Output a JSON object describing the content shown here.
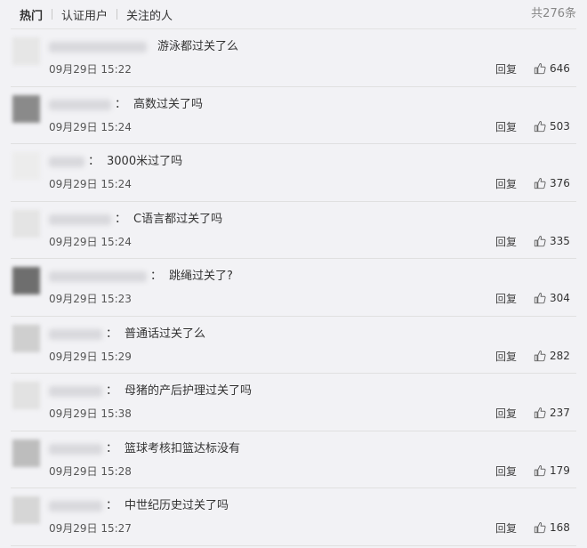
{
  "tabs": [
    {
      "label": "热门",
      "active": true
    },
    {
      "label": "认证用户",
      "active": false
    },
    {
      "label": "关注的人",
      "active": false
    }
  ],
  "total": "共276条",
  "reply_label": "回复",
  "like_icon": "thumbs-up-icon",
  "comments": [
    {
      "text": "游泳都过关了么",
      "time": "09月29日 15:22",
      "likes": "646",
      "colon": ""
    },
    {
      "text": "高数过关了吗",
      "time": "09月29日 15:24",
      "likes": "503",
      "colon": "："
    },
    {
      "text": "3000米过了吗",
      "time": "09月29日 15:24",
      "likes": "376",
      "colon": "："
    },
    {
      "text": "C语言都过关了吗",
      "time": "09月29日 15:24",
      "likes": "335",
      "colon": "："
    },
    {
      "text": "跳绳过关了?",
      "time": "09月29日 15:23",
      "likes": "304",
      "colon": "："
    },
    {
      "text": "普通话过关了么",
      "time": "09月29日 15:29",
      "likes": "282",
      "colon": "："
    },
    {
      "text": "母猪的产后护理过关了吗",
      "time": "09月29日 15:38",
      "likes": "237",
      "colon": "："
    },
    {
      "text": "篮球考核扣篮达标没有",
      "time": "09月29日 15:28",
      "likes": "179",
      "colon": "："
    },
    {
      "text": "中世纪历史过关了吗",
      "time": "09月29日 15:27",
      "likes": "168",
      "colon": "："
    }
  ]
}
